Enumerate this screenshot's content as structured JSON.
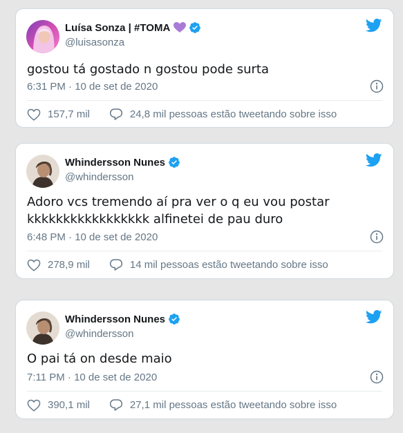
{
  "colors": {
    "twitter_blue": "#1da1f2",
    "text_primary": "#14171a",
    "text_secondary": "#657786",
    "border": "#cfd9de",
    "page_bg": "#e6e6e6",
    "purple_heart": "#a97ad6"
  },
  "tweets": [
    {
      "author_name": "Luísa Sonza | #TOMA",
      "author_emoji": "purple-heart-icon",
      "verified": true,
      "handle": "@luisasonza",
      "text": "gostou tá gostado n gostou pode surta",
      "timestamp": "6:31 PM · 10 de set de 2020",
      "likes": "157,7 mil",
      "conversation": "24,8 mil pessoas estão tweetando sobre isso"
    },
    {
      "author_name": "Whindersson Nunes",
      "verified": true,
      "handle": "@whindersson",
      "text": "Adoro vcs tremendo aí pra ver o q eu vou postar\nkkkkkkkkkkkkkkkkk alfinetei de pau duro",
      "timestamp": "6:48 PM · 10 de set de 2020",
      "likes": "278,9 mil",
      "conversation": "14 mil pessoas estão tweetando sobre isso"
    },
    {
      "author_name": "Whindersson Nunes",
      "verified": true,
      "handle": "@whindersson",
      "text": "O pai tá on desde maio",
      "timestamp": "7:11 PM · 10 de set de 2020",
      "likes": "390,1 mil",
      "conversation": "27,1 mil pessoas estão tweetando sobre isso"
    }
  ]
}
